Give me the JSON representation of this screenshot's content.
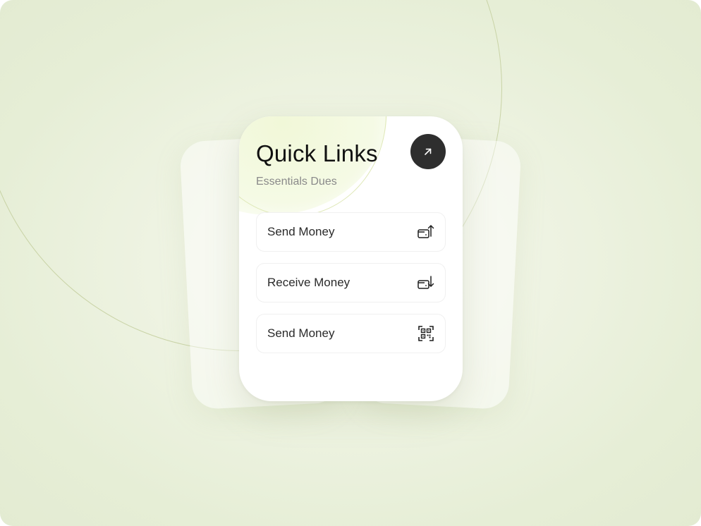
{
  "card": {
    "title": "Quick Links",
    "subtitle": "Essentials Dues"
  },
  "action": {
    "icon": "arrow-up-right-icon"
  },
  "links": [
    {
      "label": "Send Money",
      "icon": "wallet-send-icon"
    },
    {
      "label": "Receive Money",
      "icon": "wallet-receive-icon"
    },
    {
      "label": "Send Money",
      "icon": "qr-scan-icon"
    }
  ],
  "colors": {
    "background": "#e6eed6",
    "card": "#ffffff",
    "accent_glow": "#f1f8d8",
    "button": "#2e2e2e",
    "title": "#111111",
    "subtitle": "#8a8a8a"
  }
}
